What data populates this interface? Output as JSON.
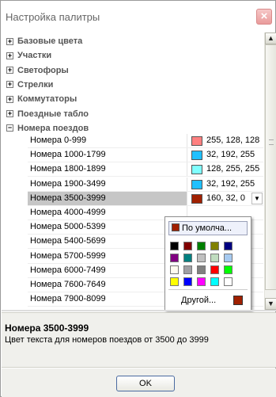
{
  "window": {
    "title": "Настройка палитры"
  },
  "categories": [
    {
      "label": "Базовые цвета",
      "expander": "+"
    },
    {
      "label": "Участки",
      "expander": "+"
    },
    {
      "label": "Светофоры",
      "expander": "+"
    },
    {
      "label": "Стрелки",
      "expander": "+"
    },
    {
      "label": "Коммутаторы",
      "expander": "+"
    },
    {
      "label": "Поездные табло",
      "expander": "+"
    },
    {
      "label": "Номера поездов",
      "expander": "−"
    }
  ],
  "rows": [
    {
      "name": "Номера 0-999",
      "value": "255, 128, 128",
      "color": "#ff8080"
    },
    {
      "name": "Номера 1000-1799",
      "value": "32, 192, 255",
      "color": "#20c0ff"
    },
    {
      "name": "Номера 1800-1899",
      "value": "128, 255, 255",
      "color": "#80ffff"
    },
    {
      "name": "Номера 1900-3499",
      "value": "32, 192, 255",
      "color": "#20c0ff"
    },
    {
      "name": "Номера 3500-3999",
      "value": "160, 32, 0",
      "color": "#a02000",
      "selected": true
    },
    {
      "name": "Номера 4000-4999"
    },
    {
      "name": "Номера 5000-5399"
    },
    {
      "name": "Номера 5400-5699"
    },
    {
      "name": "Номера 5700-5999"
    },
    {
      "name": "Номера 6000-7499"
    },
    {
      "name": "Номера 7600-7649"
    },
    {
      "name": "Номера 7900-8099"
    }
  ],
  "popup": {
    "default_label": "По умолча...",
    "other_label": "Другой...",
    "palette": [
      "#000000",
      "#800000",
      "#008000",
      "#808000",
      "#000080",
      "#800080",
      "#008080",
      "#c0c0c0",
      "#c0dcc0",
      "#a6caf0",
      "#fffbf0",
      "#a0a0a4",
      "#808080",
      "#ff0000",
      "#00ff00",
      "#ffff00",
      "#0000ff",
      "#ff00ff",
      "#00ffff",
      "#ffffff"
    ]
  },
  "description": {
    "title": "Номера 3500-3999",
    "text": "Цвет текста для номеров поездов от 3500 до 3999"
  },
  "footer": {
    "ok_label": "OK"
  }
}
